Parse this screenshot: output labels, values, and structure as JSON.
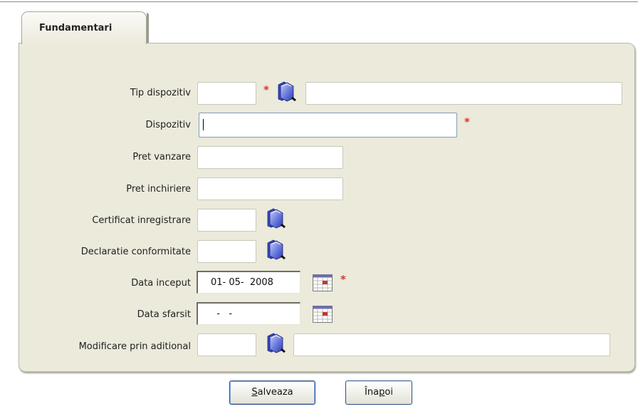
{
  "tab": {
    "label": "Fundamentari"
  },
  "form": {
    "tip_dispozitiv": {
      "label": "Tip dispozitiv",
      "code": "",
      "description": "",
      "required": "*"
    },
    "dispozitiv": {
      "label": "Dispozitiv",
      "value": "",
      "required": "*"
    },
    "pret_vanzare": {
      "label": "Pret vanzare",
      "value": ""
    },
    "pret_inchiriere": {
      "label": "Pret inchiriere",
      "value": ""
    },
    "certificat_inregistrare": {
      "label": "Certificat inregistrare",
      "value": ""
    },
    "declaratie_conformitate": {
      "label": "Declaratie conformitate",
      "value": ""
    },
    "data_inceput": {
      "label": "Data inceput",
      "value": "01- 05-  2008",
      "required": "*"
    },
    "data_sfarsit": {
      "label": "Data sfarsit",
      "value": "  -   -"
    },
    "modificare_prin_aditional": {
      "label": "Modificare prin aditional",
      "code": "",
      "description": ""
    }
  },
  "buttons": {
    "save": {
      "pre": "",
      "accel": "S",
      "post": "alveaza"
    },
    "back": {
      "pre": "Îna",
      "accel": "p",
      "post": "oi"
    }
  },
  "icons": {
    "lookup": "folder-lookup-icon",
    "calendar": "calendar-icon"
  },
  "colors": {
    "panel": "#ebeadb",
    "required": "#e0312c",
    "button_border": "#2b4d87"
  }
}
